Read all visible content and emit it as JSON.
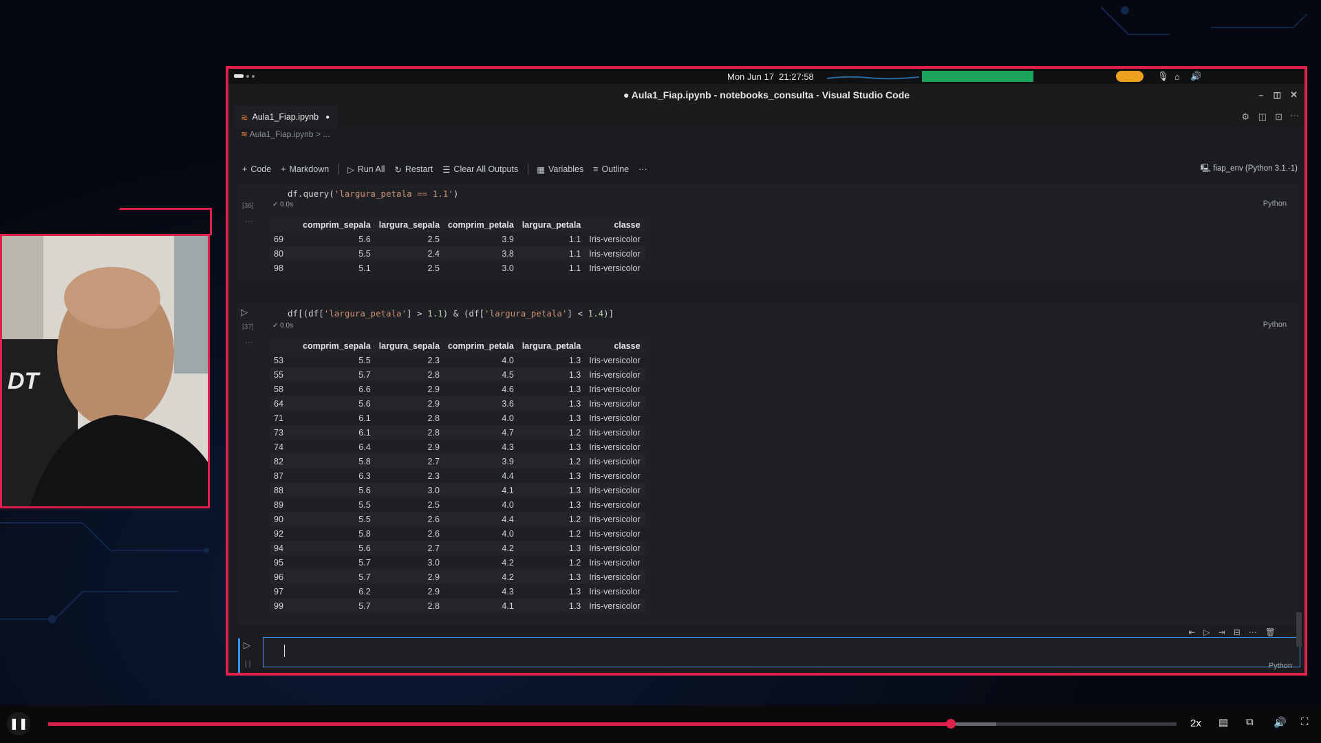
{
  "system_bar": {
    "date": "Mon Jun 17",
    "time": "21:27:58"
  },
  "window": {
    "title": "● Aula1_Fiap.ipynb - notebooks_consulta - Visual Studio Code"
  },
  "tab": {
    "label": "Aula1_Fiap.ipynb",
    "modified_dot": "●"
  },
  "breadcrumb": {
    "file": "Aula1_Fiap.ipynb",
    "rest": "> ..."
  },
  "toolbar": {
    "code": "Code",
    "markdown": "Markdown",
    "run_all": "Run All",
    "restart": "Restart",
    "clear_outputs": "Clear All Outputs",
    "variables": "Variables",
    "outline": "Outline",
    "more": "···",
    "kernel": "fiap_env (Python 3.1.-1)"
  },
  "cell1": {
    "exec": "[36]",
    "code_a": "df.query(",
    "code_str": "'largura_petala == 1.1'",
    "code_b": ")",
    "time": "0.0s",
    "lang": "Python",
    "columns": [
      "",
      "comprim_sepala",
      "largura_sepala",
      "comprim_petala",
      "largura_petala",
      "classe"
    ],
    "rows": [
      [
        "69",
        "5.6",
        "2.5",
        "3.9",
        "1.1",
        "Iris-versicolor"
      ],
      [
        "80",
        "5.5",
        "2.4",
        "3.8",
        "1.1",
        "Iris-versicolor"
      ],
      [
        "98",
        "5.1",
        "2.5",
        "3.0",
        "1.1",
        "Iris-versicolor"
      ]
    ]
  },
  "cell2": {
    "exec": "[37]",
    "code_a": "df[(df[",
    "code_s1": "'largura_petala'",
    "code_b": "] > ",
    "code_n1": "1.1",
    "code_c": ") & (df[",
    "code_s2": "'largura_petala'",
    "code_d": "] < ",
    "code_n2": "1.4",
    "code_e": ")]",
    "time": "0.0s",
    "lang": "Python",
    "columns": [
      "",
      "comprim_sepala",
      "largura_sepala",
      "comprim_petala",
      "largura_petala",
      "classe"
    ],
    "rows": [
      [
        "53",
        "5.5",
        "2.3",
        "4.0",
        "1.3",
        "Iris-versicolor"
      ],
      [
        "55",
        "5.7",
        "2.8",
        "4.5",
        "1.3",
        "Iris-versicolor"
      ],
      [
        "58",
        "6.6",
        "2.9",
        "4.6",
        "1.3",
        "Iris-versicolor"
      ],
      [
        "64",
        "5.6",
        "2.9",
        "3.6",
        "1.3",
        "Iris-versicolor"
      ],
      [
        "71",
        "6.1",
        "2.8",
        "4.0",
        "1.3",
        "Iris-versicolor"
      ],
      [
        "73",
        "6.1",
        "2.8",
        "4.7",
        "1.2",
        "Iris-versicolor"
      ],
      [
        "74",
        "6.4",
        "2.9",
        "4.3",
        "1.3",
        "Iris-versicolor"
      ],
      [
        "82",
        "5.8",
        "2.7",
        "3.9",
        "1.2",
        "Iris-versicolor"
      ],
      [
        "87",
        "6.3",
        "2.3",
        "4.4",
        "1.3",
        "Iris-versicolor"
      ],
      [
        "88",
        "5.6",
        "3.0",
        "4.1",
        "1.3",
        "Iris-versicolor"
      ],
      [
        "89",
        "5.5",
        "2.5",
        "4.0",
        "1.3",
        "Iris-versicolor"
      ],
      [
        "90",
        "5.5",
        "2.6",
        "4.4",
        "1.2",
        "Iris-versicolor"
      ],
      [
        "92",
        "5.8",
        "2.6",
        "4.0",
        "1.2",
        "Iris-versicolor"
      ],
      [
        "94",
        "5.6",
        "2.7",
        "4.2",
        "1.3",
        "Iris-versicolor"
      ],
      [
        "95",
        "5.7",
        "3.0",
        "4.2",
        "1.2",
        "Iris-versicolor"
      ],
      [
        "96",
        "5.7",
        "2.9",
        "4.2",
        "1.3",
        "Iris-versicolor"
      ],
      [
        "97",
        "6.2",
        "2.9",
        "4.3",
        "1.3",
        "Iris-versicolor"
      ],
      [
        "99",
        "5.7",
        "2.8",
        "4.1",
        "1.3",
        "Iris-versicolor"
      ]
    ]
  },
  "cell3": {
    "exec": "[ ]",
    "lang": "Python"
  },
  "player": {
    "speed": "2x",
    "progress": 0.8,
    "buffered": 0.84,
    "accent": "#e0204a"
  },
  "colors": {
    "frame": "#e0204a",
    "editor_bg": "#1b1c1f"
  }
}
